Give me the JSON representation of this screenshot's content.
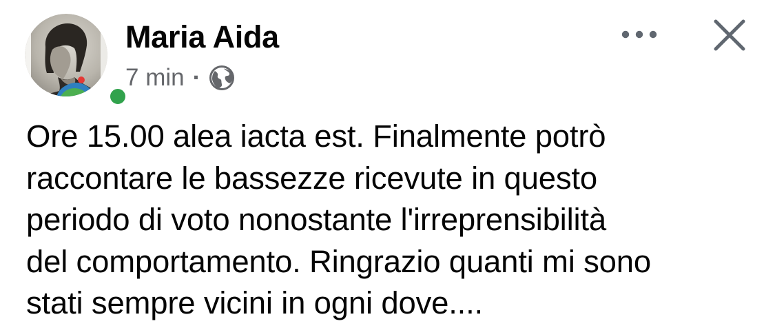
{
  "post": {
    "author_name": "Maria Aida",
    "timestamp": "7 min",
    "separator": "·",
    "audience_icon": "globe-icon",
    "text_lines": [
      "Ore 15.00 alea iacta est. Finalmente potrò",
      "raccontare le bassezze ricevute in questo",
      "periodo di voto nonostante l'irreprensibilità",
      "del comportamento. Ringrazio quanti mi sono",
      "stati sempre vicini in ogni dove...."
    ]
  },
  "header_actions": {
    "more_icon": "more-horizontal-icon",
    "close_icon": "close-icon"
  },
  "colors": {
    "primary_text": "#050505",
    "secondary_text": "#65676b",
    "presence_online": "#31a24c",
    "icon_gray": "#606770"
  }
}
